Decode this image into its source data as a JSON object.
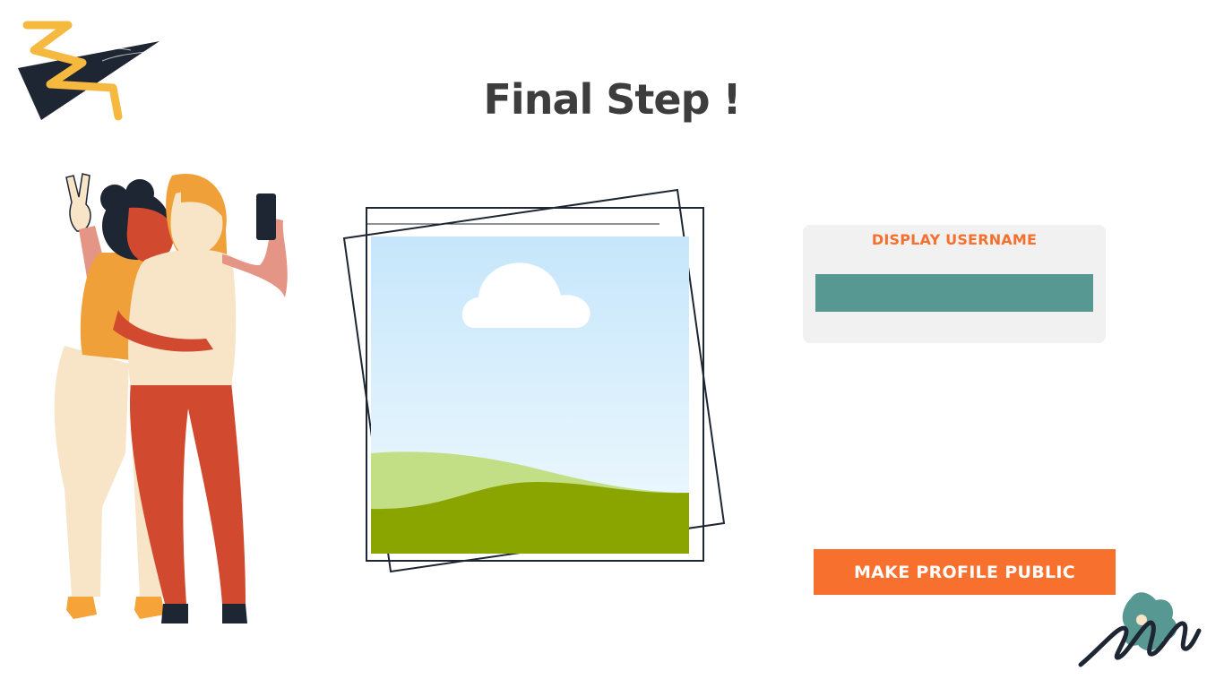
{
  "page": {
    "title": "Final Step !"
  },
  "username_card": {
    "label": "DISPLAY USERNAME",
    "input_value": "",
    "input_placeholder": ""
  },
  "actions": {
    "make_public_label": "MAKE PROFILE PUBLIC"
  },
  "colors": {
    "accent_orange": "#f7702d",
    "input_teal": "#589892",
    "card_gray": "#f1f1f1",
    "title_dark": "#3d3d3d"
  },
  "icons": {
    "top_left": "zigzag-triangle-decoration",
    "people": "selfie-couple-illustration",
    "photo": "image-placeholder-frame",
    "bottom_right": "signature-scribble-decoration"
  }
}
